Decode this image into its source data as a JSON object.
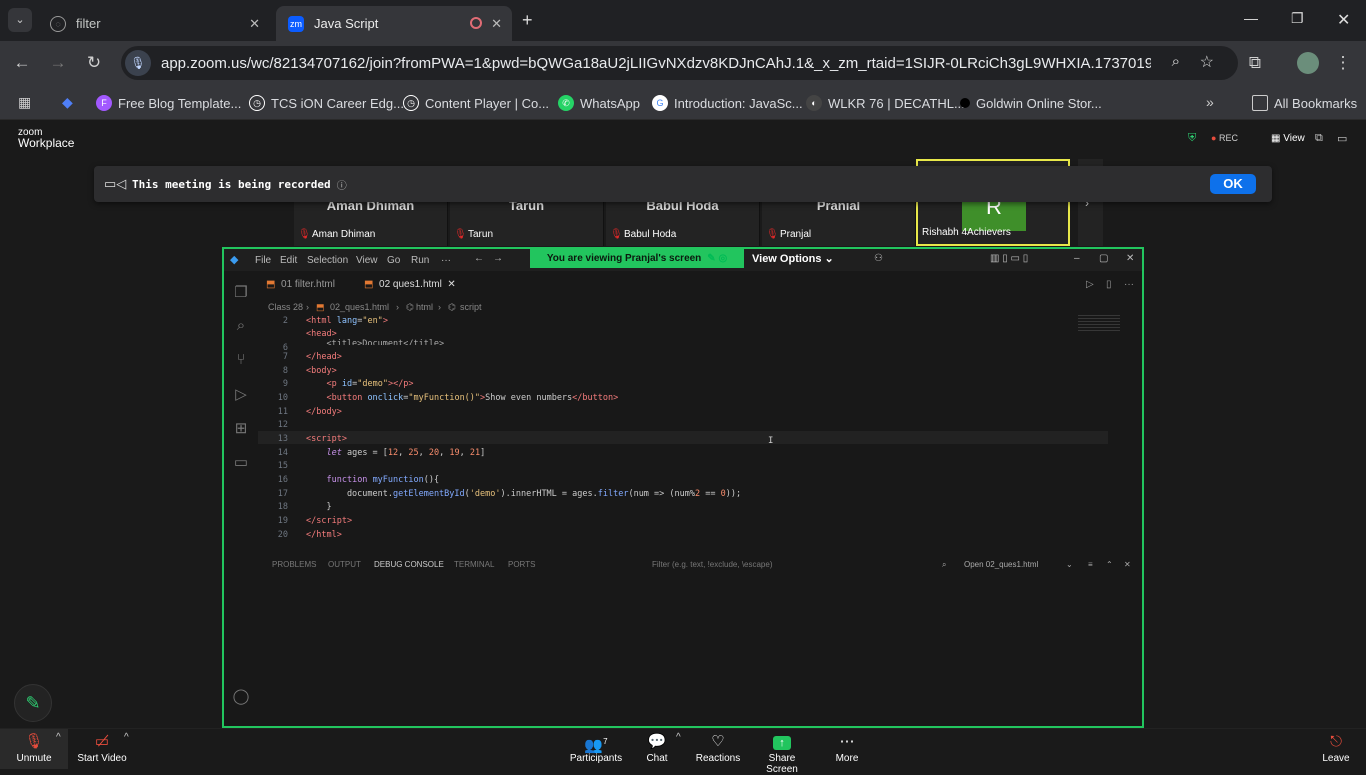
{
  "browser": {
    "tabs": [
      {
        "title": "filter",
        "active": false
      },
      {
        "title": "Java Script",
        "active": true
      }
    ],
    "url": "app.zoom.us/wc/82134707162/join?fromPWA=1&pwd=bQWGa18aU2jLIIGvNXdzv8KDJnCAhJ.1&_x_zm_rtaid=1SIJR-0LRciCh3gL9WHXIA.1737019382167.adc3a...",
    "bookmarks": [
      "Free Blog Template...",
      "TCS iON Career Edg...",
      "Content Player | Co...",
      "WhatsApp",
      "Introduction: JavaSc...",
      "WLKR 76 | DECATHL...",
      "Goldwin Online Stor..."
    ],
    "all_bookmarks": "All Bookmarks"
  },
  "zoom": {
    "logo_top": "zoom",
    "logo_bottom": "Workplace",
    "rec_label": "REC",
    "view_label": "View",
    "banner_text": "This meeting is being recorded",
    "ok_label": "OK",
    "participants": [
      {
        "name": "Aman Dhiman",
        "top": "Aman Dhiman"
      },
      {
        "name": "Tarun",
        "top": "Tarun"
      },
      {
        "name": "Babul Hoda",
        "top": "Babul Hoda"
      },
      {
        "name": "Pranjal",
        "top": "Pranjal"
      },
      {
        "name": "Rishabh 4Achievers",
        "top": "R"
      }
    ],
    "viewing_text": "You are viewing  Pranjal's screen",
    "view_options": "View Options",
    "controls": {
      "unmute": "Unmute",
      "start_video": "Start Video",
      "participants": "Participants",
      "participants_count": "7",
      "chat": "Chat",
      "reactions": "Reactions",
      "share_screen": "Share Screen",
      "more": "More",
      "leave": "Leave"
    }
  },
  "vscode": {
    "menu": [
      "File",
      "Edit",
      "Selection",
      "View",
      "Go",
      "Run",
      "···"
    ],
    "tabs": [
      "01 filter.html",
      "02 ques1.html"
    ],
    "breadcrumb": [
      "Class 28",
      "02_ques1.html",
      "html",
      "script"
    ],
    "line_numbers": [
      "2",
      "6",
      "7",
      "8",
      "9",
      "10",
      "11",
      "12",
      "13",
      "14",
      "15",
      "16",
      "17",
      "18",
      "19",
      "20"
    ],
    "panel_tabs": [
      "PROBLEMS",
      "OUTPUT",
      "DEBUG CONSOLE",
      "TERMINAL",
      "PORTS"
    ],
    "panel_filter": "Filter (e.g. text, !exclude, \\escape)",
    "panel_open": "Open 02_ques1.html"
  }
}
